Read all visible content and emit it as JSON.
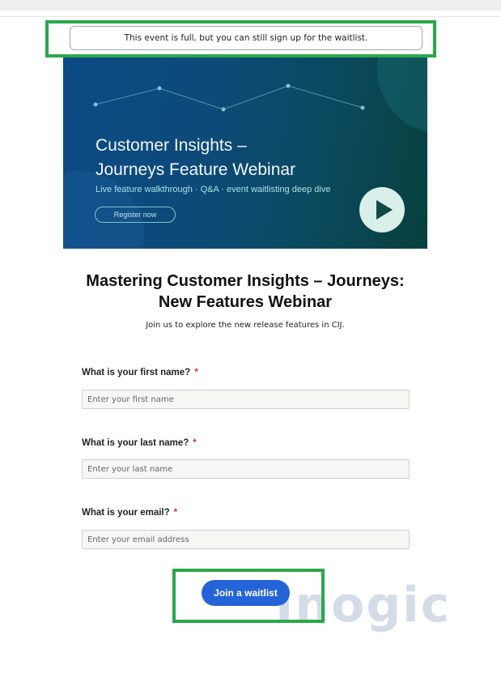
{
  "notice": {
    "text": "This event is full, but you can still sign up for the waitlist."
  },
  "banner": {
    "title_line1": "Customer Insights –",
    "title_line2": "Journeys Feature Webinar",
    "subtitle": "Live feature walkthrough · Q&A · event waitlisting deep dive",
    "button_label": "Register now",
    "play_icon": "play-icon"
  },
  "event": {
    "title_line1": "Mastering Customer Insights – Journeys:",
    "title_line2": "New Features Webinar",
    "intro": "Join us to explore the new release features in CIJ."
  },
  "form": {
    "first_name": {
      "label": "What is your first name?",
      "required_mark": "*",
      "placeholder": "Enter your first name"
    },
    "last_name": {
      "label": "What is your last name?",
      "required_mark": "*",
      "placeholder": "Enter your last name"
    },
    "email": {
      "label": "What is your email?",
      "required_mark": "*",
      "placeholder": "Enter your email address"
    },
    "submit_label": "Join a waitlist"
  },
  "watermark": {
    "text": "Inogic"
  },
  "colors": {
    "highlight_box": "#2aa84a",
    "primary_button": "#2563d9",
    "required_mark": "#c4362b",
    "banner_dark": "#0d4a86",
    "banner_teal": "#08403d"
  }
}
